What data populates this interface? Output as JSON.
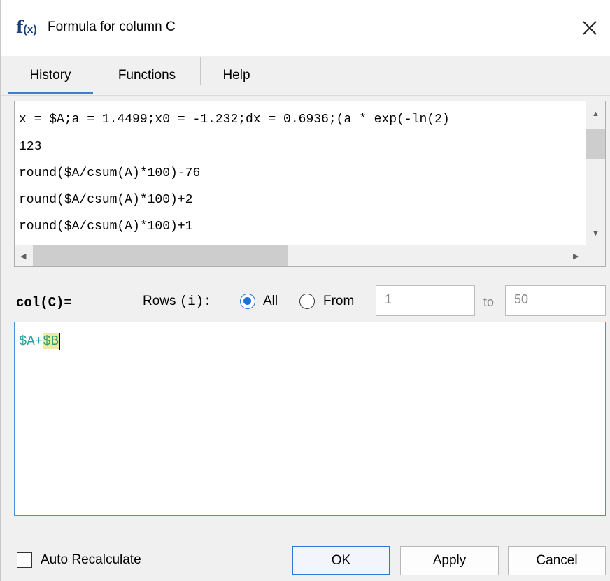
{
  "window": {
    "title": "Formula for column C",
    "icon_text": "f",
    "icon_sub": "(x)"
  },
  "tabs": [
    {
      "label": "History",
      "active": true
    },
    {
      "label": "Functions",
      "active": false
    },
    {
      "label": "Help",
      "active": false
    }
  ],
  "history": {
    "items": [
      "x = $A;a = 1.4499;x0 = -1.232;dx = 0.6936;(a * exp(-ln(2)",
      "123",
      "round($A/csum(A)*100)-76",
      "round($A/csum(A)*100)+2",
      "round($A/csum(A)*100)+1"
    ]
  },
  "rows": {
    "col_label": "col(C)=",
    "rows_prefix": "Rows",
    "rows_var": "(i):",
    "option_all": "All",
    "option_from": "From",
    "selected": "All",
    "from_value": "1",
    "to_label": "to",
    "to_value": "50"
  },
  "editor": {
    "formula_plain": "$A+",
    "formula_highlight": "$B"
  },
  "footer": {
    "auto_recalculate_label": "Auto Recalculate",
    "auto_recalculate_checked": false,
    "ok_label": "OK",
    "apply_label": "Apply",
    "cancel_label": "Cancel"
  },
  "colors": {
    "accent": "#3a7fd0",
    "formula_text": "#2aa0a0",
    "highlight_bg": "#ecec9e"
  }
}
